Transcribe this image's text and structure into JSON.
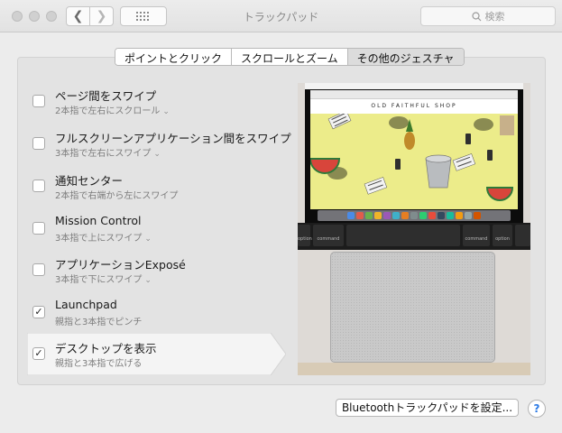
{
  "window": {
    "title": "トラックパッド"
  },
  "search": {
    "placeholder": "検索"
  },
  "icons": {
    "back": "chevron-left-icon",
    "forward": "chevron-right-icon",
    "grid": "grid-icon",
    "search": "search-icon",
    "check": "checkmark-icon",
    "help": "question-mark-icon"
  },
  "tabs": [
    {
      "label": "ポイントとクリック",
      "active": false
    },
    {
      "label": "スクロールとズーム",
      "active": false
    },
    {
      "label": "その他のジェスチャ",
      "active": true
    }
  ],
  "options": [
    {
      "title": "ページ間をスワイプ",
      "subtitle": "2本指で左右にスクロール",
      "checked": false,
      "dropdown": true
    },
    {
      "title": "フルスクリーンアプリケーション間をスワイプ",
      "subtitle": "3本指で左右にスワイプ",
      "checked": false,
      "dropdown": true
    },
    {
      "title": "通知センター",
      "subtitle": "2本指で右端から左にスワイプ",
      "checked": false,
      "dropdown": false
    },
    {
      "title": "Mission Control",
      "subtitle": "3本指で上にスワイプ",
      "checked": false,
      "dropdown": true
    },
    {
      "title": "アプリケーションExposé",
      "subtitle": "3本指で下にスワイプ",
      "checked": false,
      "dropdown": true
    },
    {
      "title": "Launchpad",
      "subtitle": "親指と3本指でピンチ",
      "checked": true,
      "dropdown": false
    },
    {
      "title": "デスクトップを表示",
      "subtitle": "親指と3本指で広げる",
      "checked": true,
      "dropdown": false
    }
  ],
  "preview": {
    "site_name": "OLD FAITHFUL SHOP",
    "keys": {
      "option": "option",
      "command": "command"
    }
  },
  "buttons": {
    "bluetooth": "Bluetoothトラックパッドを設定...",
    "help": "?"
  },
  "colors": {
    "accent": "#2d7be5",
    "site_background": "#ecec8a"
  }
}
